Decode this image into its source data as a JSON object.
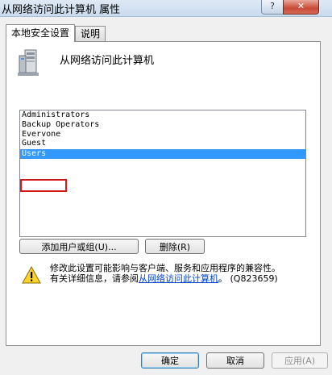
{
  "window": {
    "title": "从网络访问此计算机 属性",
    "help_glyph": "?",
    "close_glyph": "✕"
  },
  "tabs": [
    {
      "label": "本地安全设置",
      "active": true
    },
    {
      "label": "说明",
      "active": false
    }
  ],
  "policy": {
    "icon": "server-icon",
    "name": "从网络访问此计算机"
  },
  "accounts": [
    {
      "name": "Administrators",
      "selected": false
    },
    {
      "name": "Backup Operators",
      "selected": false
    },
    {
      "name": "Everyone",
      "selected": false
    },
    {
      "name": "Guest",
      "selected": false
    },
    {
      "name": "Users",
      "selected": true
    }
  ],
  "highlight_color": "#d41919",
  "buttons": {
    "add": "添加用户或组(U)...",
    "remove": "删除(R)"
  },
  "warning": {
    "icon": "warning-icon",
    "line1": "修改此设置可能影响与客户端、服务和应用程序的兼容性。",
    "line2_prefix": "有关详细信息，请参阅",
    "link": "从网络访问此计算机",
    "line2_suffix": "。 (Q823659)"
  },
  "footer": {
    "ok": "确定",
    "cancel": "取消",
    "apply": "应用(A)"
  }
}
